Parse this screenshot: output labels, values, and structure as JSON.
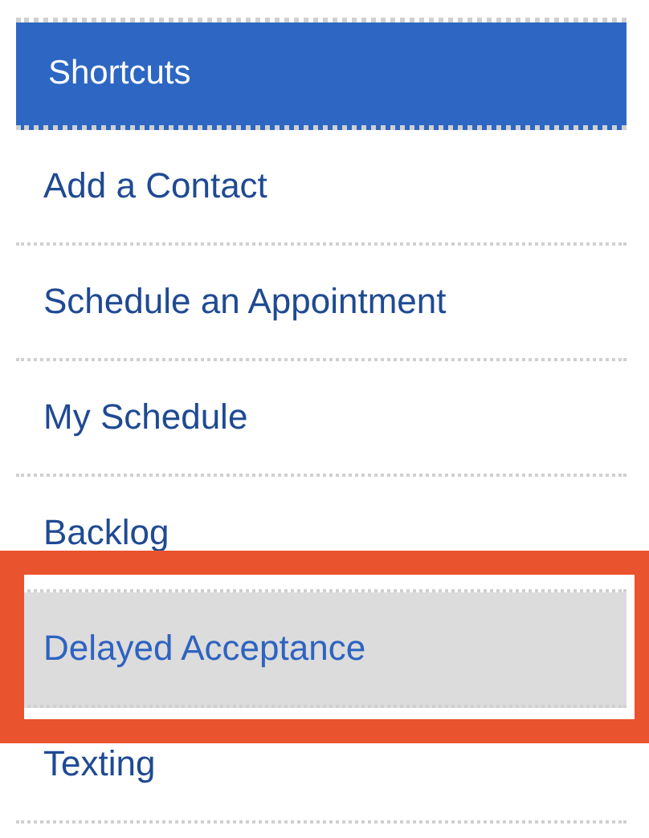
{
  "panel": {
    "title": "Shortcuts"
  },
  "items": [
    {
      "label": "Add a Contact",
      "selected": false,
      "highlighted": false
    },
    {
      "label": "Schedule an Appointment",
      "selected": false,
      "highlighted": false
    },
    {
      "label": "My Schedule",
      "selected": false,
      "highlighted": false
    },
    {
      "label": "Backlog",
      "selected": false,
      "highlighted": false
    },
    {
      "label": "Delayed Acceptance",
      "selected": true,
      "highlighted": true
    },
    {
      "label": "Texting",
      "selected": false,
      "highlighted": false
    }
  ]
}
